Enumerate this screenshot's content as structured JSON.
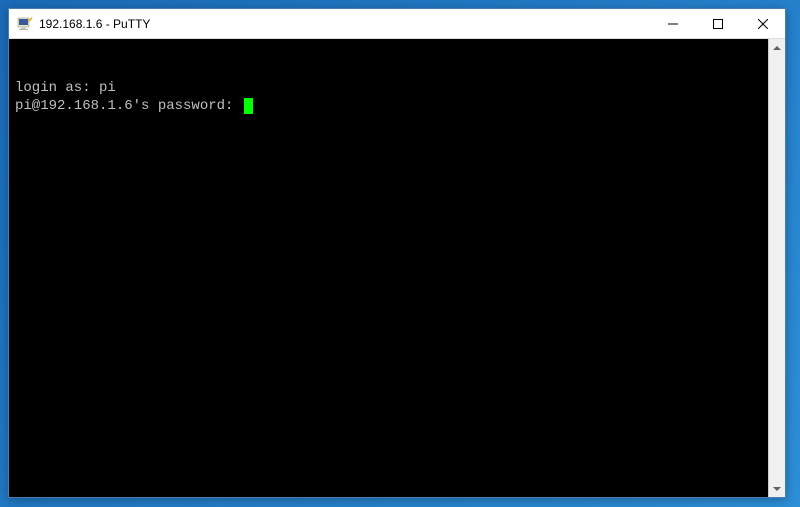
{
  "window": {
    "title": "192.168.1.6 - PuTTY",
    "icon_name": "putty-icon"
  },
  "terminal": {
    "lines": [
      {
        "prompt": "login as: ",
        "input": "pi"
      },
      {
        "prompt": "pi@192.168.1.6's password: ",
        "input": ""
      }
    ],
    "cursor_color": "#00ff00"
  }
}
